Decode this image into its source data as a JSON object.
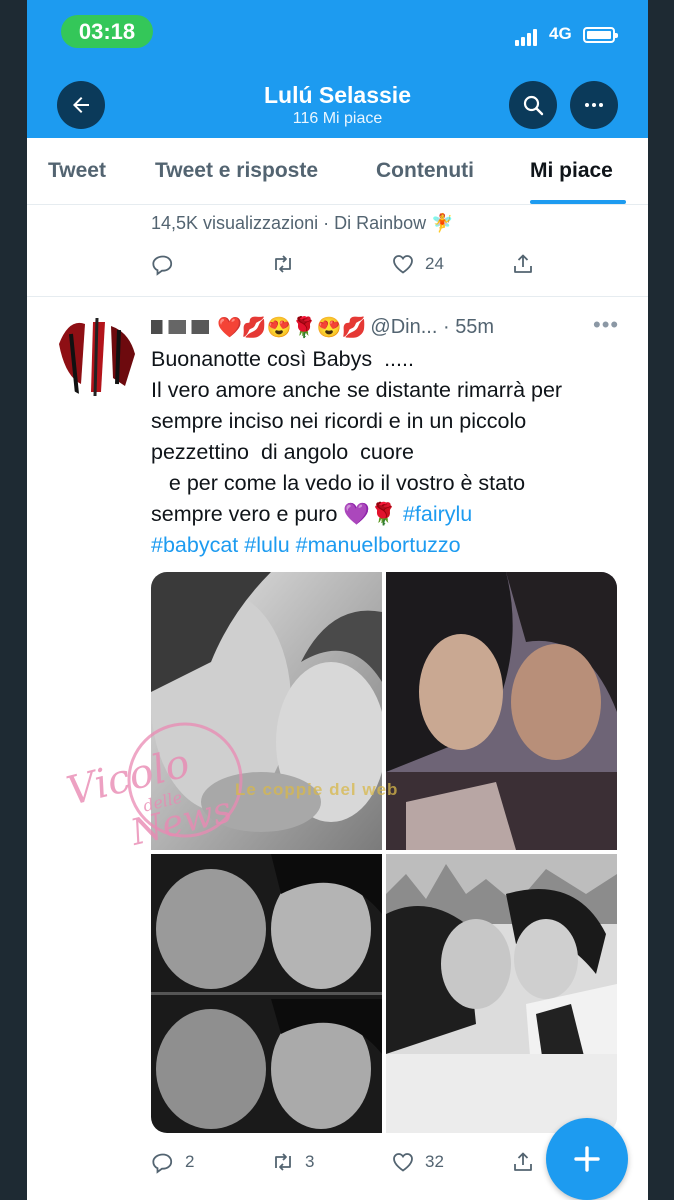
{
  "status_bar": {
    "time": "03:18",
    "network": "4G"
  },
  "profile_header": {
    "name": "Lulú Selassie",
    "likes_count": "116 Mi piace"
  },
  "tabs": [
    {
      "label": "Tweet"
    },
    {
      "label": "Tweet e risposte"
    },
    {
      "label": "Contenuti"
    },
    {
      "label": "Mi piace"
    }
  ],
  "previous_tweet": {
    "meta": "14,5K visualizzazioni · Di Rainbow 🧚",
    "likes": "24"
  },
  "tweet": {
    "handle": "@Din...",
    "time": "55m",
    "name_emojis": "❤️💋😍🌹😍💋",
    "lines": [
      "Buonanotte così Babys  .....",
      "Il vero amore anche se distante rimarrà per",
      "sempre inciso nei ricordi e in un piccolo",
      "pezzettino  di angolo  cuore",
      "   e per come la vedo io il vostro è stato",
      "sempre vero e puro 💜🌹"
    ],
    "hashtag_1": "#fairylu",
    "hashtags_2": [
      "#babycat",
      "#lulu",
      "#manuelbortuzzo"
    ],
    "replies": "2",
    "retweets": "3",
    "likes": "32"
  },
  "watermark": {
    "text_1": "Vicolo",
    "text_2": "delle",
    "text_3": "News",
    "overlay": "Le coppie del web"
  },
  "colors": {
    "accent": "#1d9bf0",
    "header_button": "#0b3a5a",
    "status_pill": "#34c759",
    "text": "#0f1419",
    "muted": "#536471"
  }
}
